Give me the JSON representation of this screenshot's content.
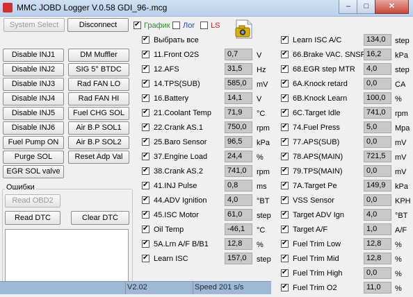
{
  "window": {
    "title": "MMC JOBD Logger V.0.58 GDI_96-.mcg"
  },
  "window_controls": {
    "minimize": "–",
    "maximize": "□",
    "close": "✕"
  },
  "toolbar": {
    "system_select": "System Select",
    "disconnect": "Disconnect",
    "graph_label": "График",
    "log_label": "Лог",
    "ls_label": "LS",
    "graph_color": "#2e8b2e",
    "log_color": "#1a4fd6",
    "ls_color": "#d62020"
  },
  "left_buttons": [
    {
      "left": "Disable INJ1",
      "right": "DM Muffler"
    },
    {
      "left": "Disable INJ2",
      "right": "SIG 5° BTDC"
    },
    {
      "left": "Disable INJ3",
      "right": "Rad FAN LO"
    },
    {
      "left": "Disable INJ4",
      "right": "Rad FAN HI"
    },
    {
      "left": "Disable INJ5",
      "right": "Fuel CHG SOL"
    },
    {
      "left": "Disable INJ6",
      "right": "Air B.P SOL1"
    },
    {
      "left": "Fuel Pump ON",
      "right": "Air B.P SOL2"
    },
    {
      "left": "Purge SOL",
      "right": "Reset Adp Val"
    }
  ],
  "egr_button": "EGR SOL valve",
  "errors": {
    "title": "Ошибки",
    "read_obd2": "Read OBD2",
    "read_dtc": "Read DTC",
    "clear_dtc": "Clear DTC"
  },
  "select_all": "Выбрать все",
  "params_mid": [
    {
      "label": "11.Front O2S",
      "value": "0,7",
      "unit": "V"
    },
    {
      "label": "12.AFS",
      "value": "31,5",
      "unit": "Hz"
    },
    {
      "label": "14.TPS(SUB)",
      "value": "585,0",
      "unit": "mV"
    },
    {
      "label": "16.Battery",
      "value": "14,1",
      "unit": "V"
    },
    {
      "label": "21.Coolant Temp",
      "value": "71,9",
      "unit": "°C"
    },
    {
      "label": "22.Crank AS.1",
      "value": "750,0",
      "unit": "rpm"
    },
    {
      "label": "25.Baro Sensor",
      "value": "96,5",
      "unit": "kPa"
    },
    {
      "label": "37.Engine Load",
      "value": "24,4",
      "unit": "%"
    },
    {
      "label": "38.Crank AS.2",
      "value": "741,0",
      "unit": "rpm"
    },
    {
      "label": "41.INJ Pulse",
      "value": "0,8",
      "unit": "ms"
    },
    {
      "label": "44.ADV Ignition",
      "value": "4,0",
      "unit": "°BT"
    },
    {
      "label": "45.ISC Motor",
      "value": "61,0",
      "unit": "step"
    },
    {
      "label": "Oil Temp",
      "value": "-46,1",
      "unit": "°C"
    },
    {
      "label": "5A.Lrn A/F B/B1",
      "value": "12,8",
      "unit": "%"
    },
    {
      "label": "Learn ISC",
      "value": "157,0",
      "unit": "step"
    }
  ],
  "params_right": [
    {
      "label": "Learn ISC A/C",
      "value": "134,0",
      "unit": "step"
    },
    {
      "label": "66.Brake VAC. SNSR",
      "value": "16,2",
      "unit": "kPa"
    },
    {
      "label": "68.EGR step MTR",
      "value": "4,0",
      "unit": "step"
    },
    {
      "label": "6A.Knock retard",
      "value": "0,0",
      "unit": "CA"
    },
    {
      "label": "6B.Knock Learn",
      "value": "100,0",
      "unit": "%"
    },
    {
      "label": "6C.Target Idle",
      "value": "741,0",
      "unit": "rpm"
    },
    {
      "label": "74.Fuel Press",
      "value": "5,0",
      "unit": "Mpa"
    },
    {
      "label": "77.APS(SUB)",
      "value": "0,0",
      "unit": "mV"
    },
    {
      "label": "78.APS(MAIN)",
      "value": "721,5",
      "unit": "mV"
    },
    {
      "label": "79.TPS(MAIN)",
      "value": "0,0",
      "unit": "mV"
    },
    {
      "label": "7A.Target Pe",
      "value": "149,9",
      "unit": "kPa"
    },
    {
      "label": "VSS Sensor",
      "value": "0,0",
      "unit": "KPH"
    },
    {
      "label": "Target ADV Ign",
      "value": "4,0",
      "unit": "°BT"
    },
    {
      "label": "Target A/F",
      "value": "1,0",
      "unit": "A/F"
    },
    {
      "label": "Fuel Trim Low",
      "value": "12,8",
      "unit": "%"
    },
    {
      "label": "Fuel Trim Mid",
      "value": "12,8",
      "unit": "%"
    },
    {
      "label": "Fuel Trim High",
      "value": "0,0",
      "unit": "%"
    },
    {
      "label": "Fuel Trim O2",
      "value": "11,0",
      "unit": "%"
    }
  ],
  "status": {
    "version": "V2.02",
    "speed": "Speed 201 s/s"
  }
}
